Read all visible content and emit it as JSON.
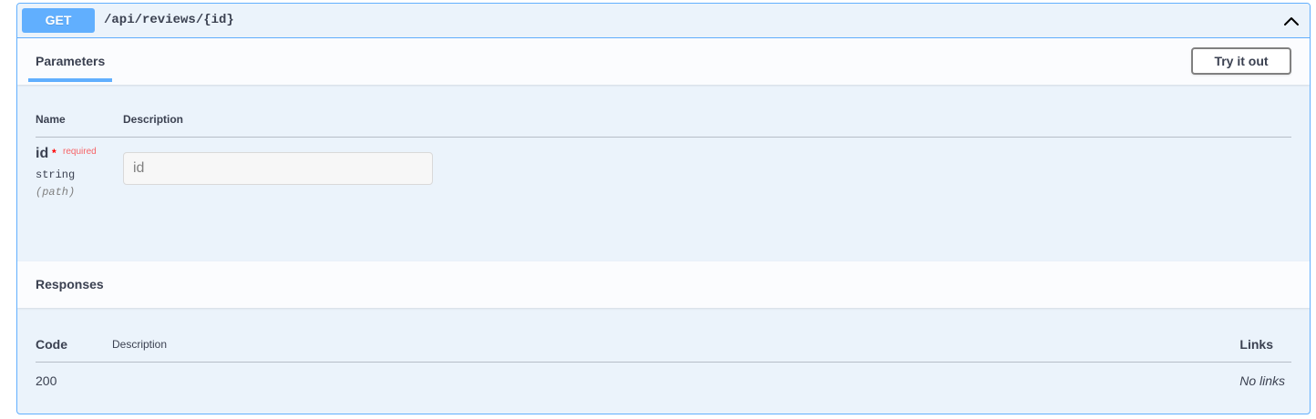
{
  "operation": {
    "method": "GET",
    "path": "/api/reviews/{id}",
    "accent_color": "#61affe",
    "collapse_icon": "chevron-up-icon"
  },
  "parameters": {
    "tab_label": "Parameters",
    "try_button_label": "Try it out",
    "columns": {
      "name": "Name",
      "description": "Description"
    },
    "items": [
      {
        "name": "id",
        "required_mark": "*",
        "required_label": "required",
        "type": "string",
        "location": "(path)",
        "input_placeholder": "id",
        "input_value": ""
      }
    ]
  },
  "responses": {
    "title": "Responses",
    "columns": {
      "code": "Code",
      "description": "Description",
      "links": "Links"
    },
    "rows": [
      {
        "code": "200",
        "description": "",
        "links": "No links"
      }
    ]
  }
}
